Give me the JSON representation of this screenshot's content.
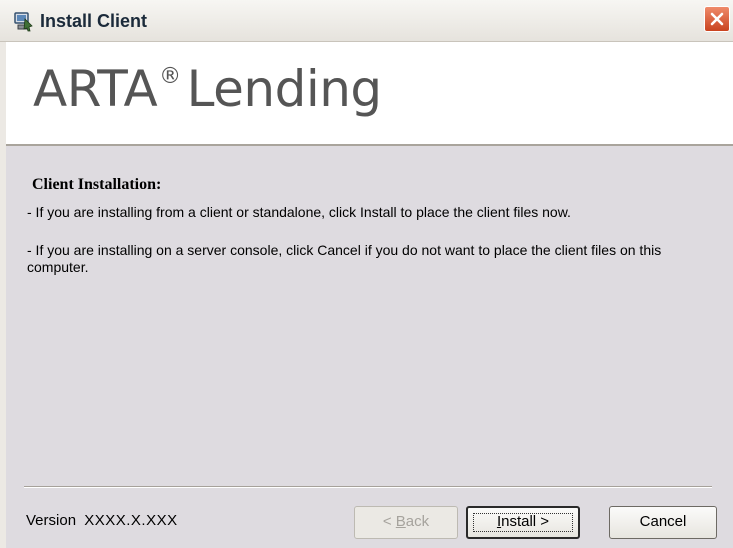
{
  "window": {
    "title": "Install Client",
    "icon": "installer-computer-icon",
    "close_icon": "close-x-icon"
  },
  "banner": {
    "product_name": "ARTA",
    "registered_mark": "®",
    "product_suffix": "Lending"
  },
  "content": {
    "heading": "Client Installation:",
    "paragraph1": "- If you are installing from a client or standalone, click Install to place the client files now.",
    "paragraph2": "- If you are installing on a server console, click Cancel if you do not want to place the client files on this computer."
  },
  "footer": {
    "version_label": "Version",
    "version_number": "XXXX.X.XXX"
  },
  "buttons": {
    "back": {
      "prefix": "< ",
      "accel": "B",
      "rest": "ack",
      "enabled": false
    },
    "install": {
      "accel": "I",
      "rest": "nstall >",
      "default": true
    },
    "cancel": "Cancel"
  },
  "colors": {
    "content_bg": "#dedbe0",
    "close_button": "#c9431f",
    "disabled_text": "#a6a39d"
  }
}
